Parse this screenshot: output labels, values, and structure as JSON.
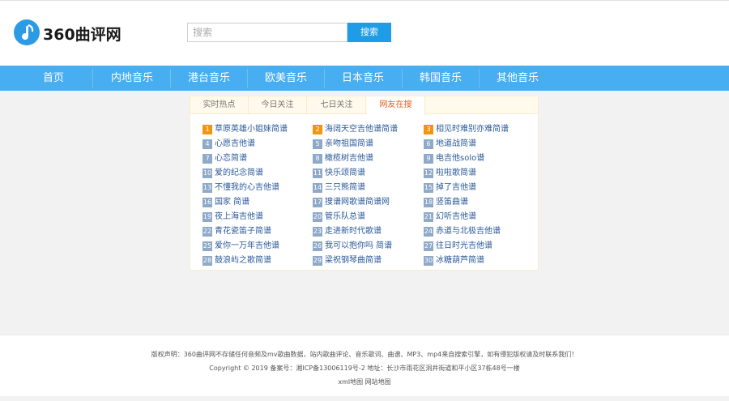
{
  "header": {
    "logo_text": "360曲评网",
    "search": {
      "placeholder": "搜索",
      "button_label": "搜索"
    }
  },
  "nav": {
    "items": [
      "首页",
      "内地音乐",
      "港台音乐",
      "欧美音乐",
      "日本音乐",
      "韩国音乐",
      "其他音乐"
    ]
  },
  "panel": {
    "tabs": [
      {
        "label": "实时热点",
        "active": false
      },
      {
        "label": "今日关注",
        "active": false
      },
      {
        "label": "七日关注",
        "active": false
      },
      {
        "label": "网友在搜",
        "active": true
      }
    ],
    "items": [
      {
        "rank": "1",
        "title": "草原英雄小姐妹简谱"
      },
      {
        "rank": "2",
        "title": "海阔天空吉他谱简谱"
      },
      {
        "rank": "3",
        "title": "相见时难别亦难简谱"
      },
      {
        "rank": "4",
        "title": "心愿吉他谱"
      },
      {
        "rank": "5",
        "title": "亲吻祖国简谱"
      },
      {
        "rank": "6",
        "title": "地道战简谱"
      },
      {
        "rank": "7",
        "title": "心恋简谱"
      },
      {
        "rank": "8",
        "title": "橄榄树吉他谱"
      },
      {
        "rank": "9",
        "title": "电吉他solo谱"
      },
      {
        "rank": "10",
        "title": "爱的纪念简谱"
      },
      {
        "rank": "11",
        "title": "快乐颂简谱"
      },
      {
        "rank": "12",
        "title": "啦啦歌简谱"
      },
      {
        "rank": "13",
        "title": "不懂我的心吉他谱"
      },
      {
        "rank": "14",
        "title": "三只熊简谱"
      },
      {
        "rank": "15",
        "title": "掉了吉他谱"
      },
      {
        "rank": "16",
        "title": "国家 简谱"
      },
      {
        "rank": "17",
        "title": "搜谱网歌谱简谱网"
      },
      {
        "rank": "18",
        "title": "竖笛曲谱"
      },
      {
        "rank": "19",
        "title": "夜上海吉他谱"
      },
      {
        "rank": "20",
        "title": "管乐队总谱"
      },
      {
        "rank": "21",
        "title": "幻听吉他谱"
      },
      {
        "rank": "22",
        "title": "青花瓷笛子简谱"
      },
      {
        "rank": "23",
        "title": "走进新时代歌谱"
      },
      {
        "rank": "24",
        "title": "赤道与北极吉他谱"
      },
      {
        "rank": "25",
        "title": "爱你一万年吉他谱"
      },
      {
        "rank": "26",
        "title": "我可以抱你吗 简谱"
      },
      {
        "rank": "27",
        "title": "往日时光吉他谱"
      },
      {
        "rank": "28",
        "title": "鼓浪屿之歌简谱"
      },
      {
        "rank": "29",
        "title": "梁祝钢琴曲简谱"
      },
      {
        "rank": "30",
        "title": "冰糖葫芦简谱"
      }
    ]
  },
  "footer": {
    "disclaimer": "版权声明：360曲评网不存储任何音频及mv歌曲数据，站内歌曲评论、音乐歌词、曲谱、MP3、mp4来自搜索引擎，如有侵犯版权请及时联系我们！",
    "copyright": "Copyright © 2019 备案号：湘ICP备13006119号-2 地址：长沙市雨花区洞井街道和平小区37栋48号一楼",
    "links": [
      "xml地图",
      "网站地图"
    ]
  },
  "colors": {
    "nav_bg": "#47aef1",
    "search_button_bg": "#1e9de6",
    "active_tab_text": "#e85c16",
    "top_badge": "#f29611",
    "badge": "#8fa9c9",
    "link_text": "#2b5a99"
  }
}
